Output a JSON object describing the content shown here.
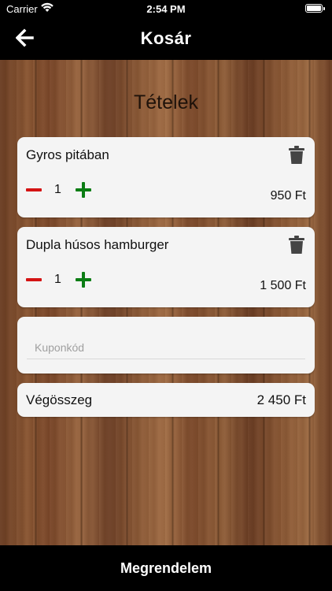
{
  "status_bar": {
    "carrier": "Carrier",
    "time": "2:54 PM",
    "icons": [
      "wifi-icon",
      "battery-icon"
    ]
  },
  "nav": {
    "title": "Kosár",
    "back_icon": "arrow-left-icon"
  },
  "section_title": "Tételek",
  "items": [
    {
      "name": "Gyros pitában",
      "quantity": "1",
      "price": "950 Ft"
    },
    {
      "name": "Dupla húsos hamburger",
      "quantity": "1",
      "price": "1 500 Ft"
    }
  ],
  "coupon": {
    "placeholder": "Kuponkód",
    "value": ""
  },
  "total": {
    "label": "Végösszeg",
    "value": "2 450 Ft"
  },
  "order_button": {
    "label": "Megrendelem"
  },
  "colors": {
    "minus": "#d41313",
    "plus": "#0b7d14",
    "card": "#f4f4f4",
    "bar": "#000000"
  }
}
